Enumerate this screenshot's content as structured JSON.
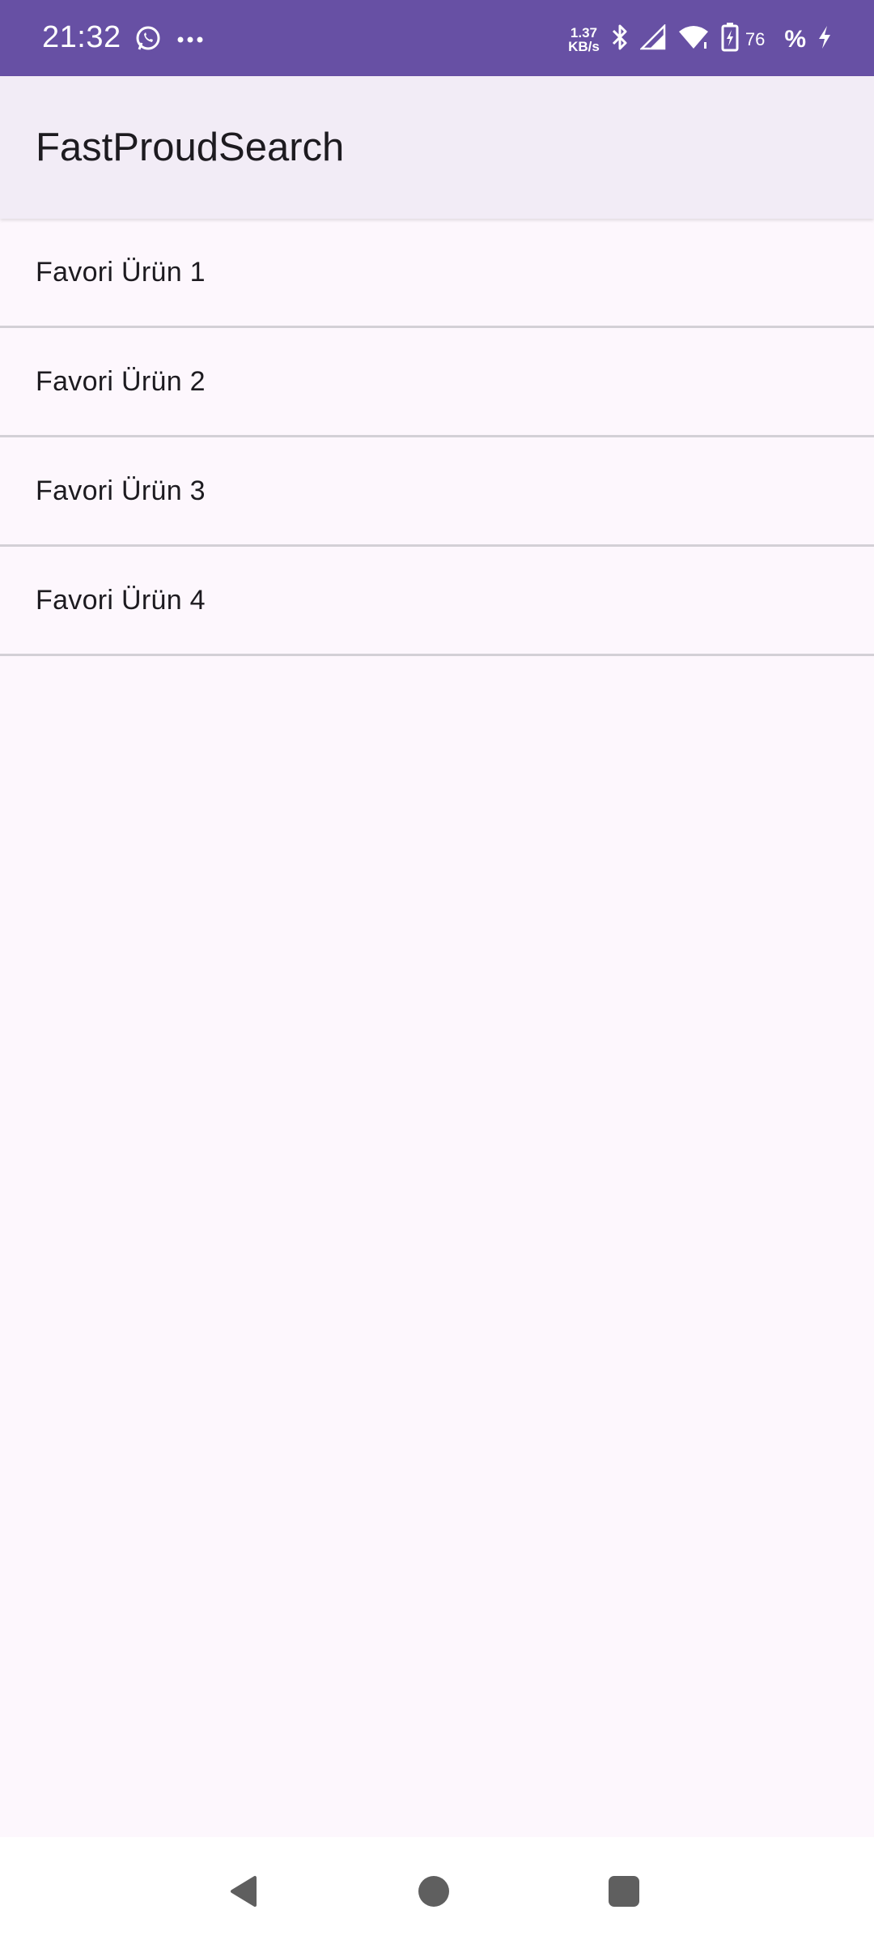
{
  "status_bar": {
    "time": "21:32",
    "net_speed_value": "1.37",
    "net_speed_unit": "KB/s",
    "battery_level": "76",
    "battery_percent_symbol": "%",
    "icons": [
      "whatsapp-icon",
      "more-dots-icon",
      "bluetooth-icon",
      "signal-icon",
      "wifi-icon",
      "battery-charging-icon",
      "charging-bolt-icon"
    ],
    "background_color": "#6750a4"
  },
  "app_bar": {
    "title": "FastProudSearch",
    "background_color": "#f2ecf6"
  },
  "favorites": {
    "items": [
      {
        "label": "Favori Ürün 1"
      },
      {
        "label": "Favori Ürün 2"
      },
      {
        "label": "Favori Ürün 3"
      },
      {
        "label": "Favori Ürün 4"
      }
    ]
  },
  "nav_bar": {
    "buttons": [
      "back-icon",
      "home-icon",
      "recents-icon"
    ]
  }
}
